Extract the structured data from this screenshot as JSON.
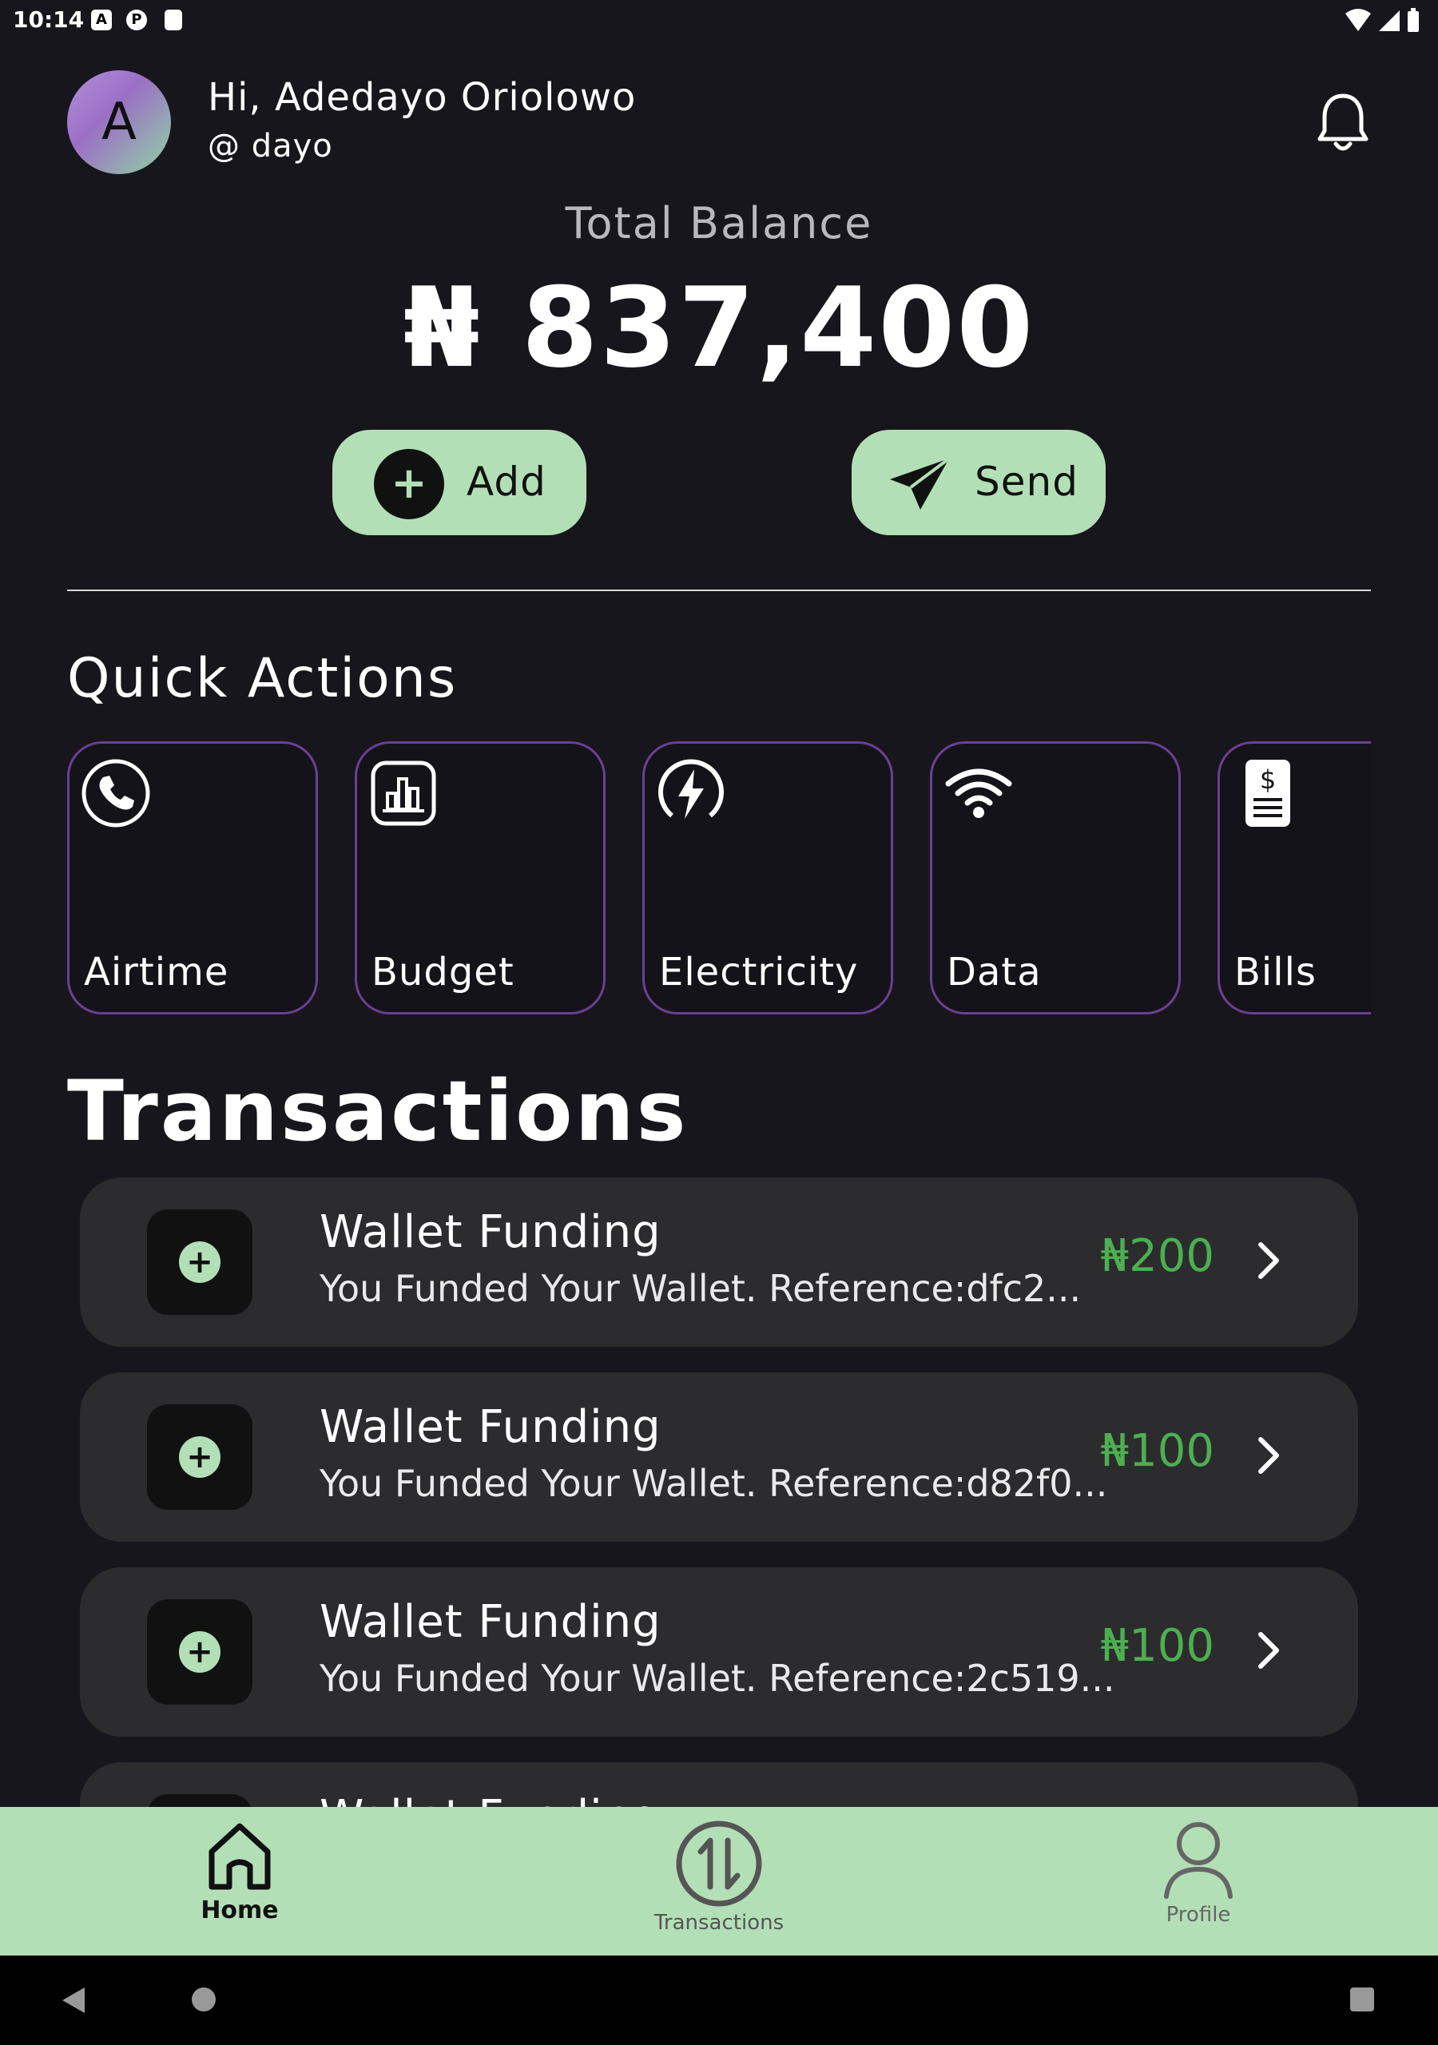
{
  "status_bar": {
    "time": "10:14"
  },
  "header": {
    "avatar_letter": "A",
    "greeting": "Hi, Adedayo Oriolowo",
    "handle": "@ dayo"
  },
  "balance": {
    "label": "Total Balance",
    "amount": "₦ 837,400"
  },
  "actions": {
    "add_label": "Add",
    "send_label": "Send"
  },
  "quick_actions": {
    "title": "Quick Actions",
    "items": [
      {
        "label": "Airtime",
        "icon": "phone-icon"
      },
      {
        "label": "Budget",
        "icon": "chart-icon"
      },
      {
        "label": "Electricity",
        "icon": "lightning-icon"
      },
      {
        "label": "Data",
        "icon": "wifi-icon"
      },
      {
        "label": "Bills",
        "icon": "bill-icon"
      }
    ]
  },
  "transactions": {
    "title": "Transactions",
    "items": [
      {
        "name": "Wallet Funding",
        "description": "You Funded Your Wallet. Reference:dfc2...",
        "amount": "₦200"
      },
      {
        "name": "Wallet Funding",
        "description": "You Funded Your Wallet. Reference:d82f0...",
        "amount": "₦100"
      },
      {
        "name": "Wallet Funding",
        "description": "You Funded Your Wallet. Reference:2c519...",
        "amount": "₦100"
      },
      {
        "name": "Wallet Funding",
        "description": "",
        "amount": ""
      }
    ]
  },
  "bottom_nav": {
    "home": "Home",
    "transactions": "Transactions",
    "profile": "Profile"
  },
  "colors": {
    "accent": "#b3dfb6",
    "card_border": "#6d3f93",
    "amount_green": "#4caf50",
    "background": "#17161c"
  }
}
